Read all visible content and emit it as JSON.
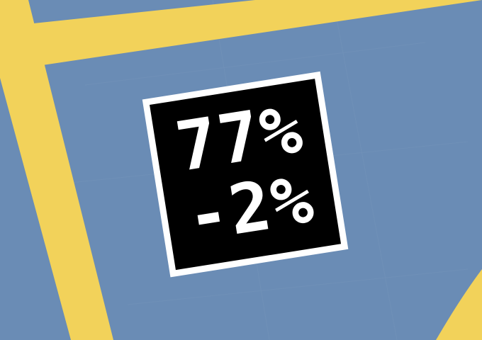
{
  "scene": {
    "description_colors": {
      "road_surface": "#6a8cb5",
      "lane_marking": "#f2d25a",
      "sign_background": "#000000",
      "sign_foreground": "#ffffff"
    }
  },
  "sign": {
    "line1": "77%",
    "line2": "-2%"
  }
}
